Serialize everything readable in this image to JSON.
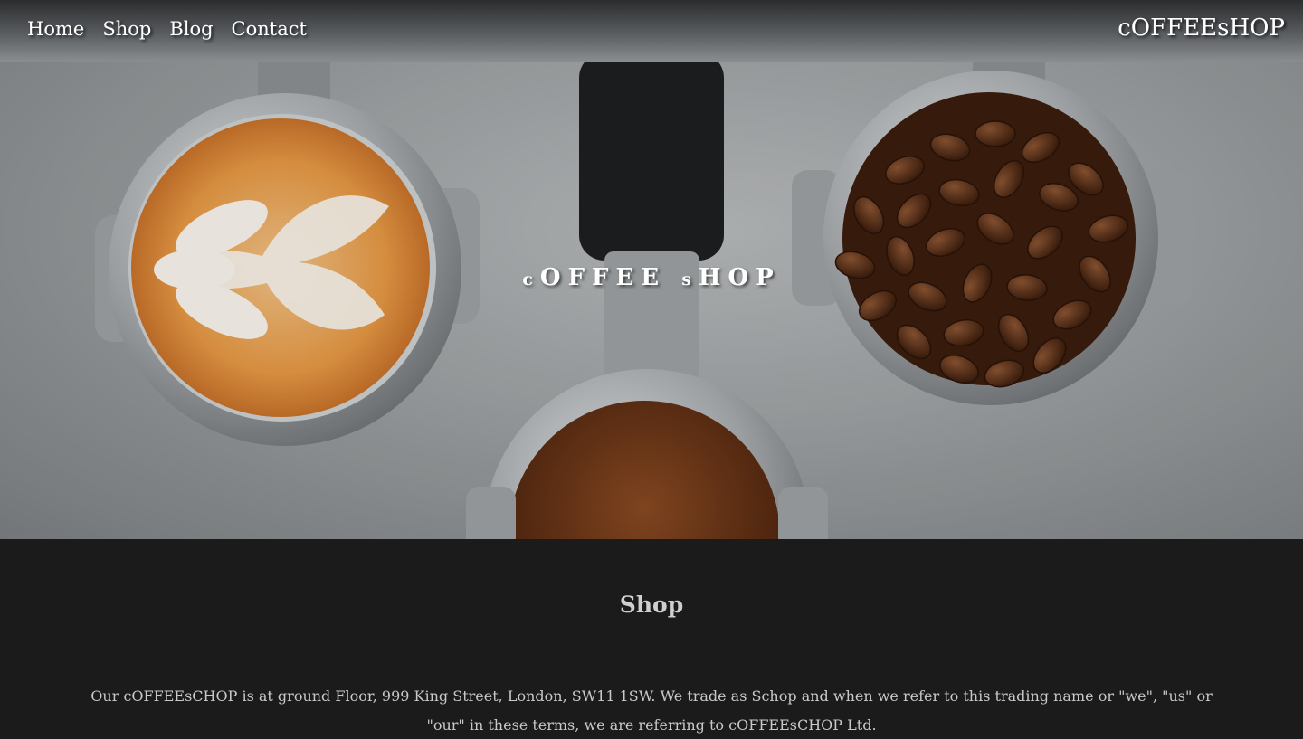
{
  "header": {
    "nav": [
      {
        "label": "Home"
      },
      {
        "label": "Shop"
      },
      {
        "label": "Blog"
      },
      {
        "label": "Contact"
      }
    ],
    "brand": "cOFFEEsHOP"
  },
  "hero": {
    "title_prefix": "c",
    "title_mid": "OFFEE",
    "title_s": "s",
    "title_end": "HOP"
  },
  "section": {
    "title": "Shop",
    "text": "Our cOFFEEsCHOP is at ground Floor, 999 King Street, London, SW11 1SW. We trade as Schop and when we refer to this trading name or \"we\", \"us\" or \"our\" in these terms, we are referring to cOFFEEsCHOP Ltd."
  }
}
